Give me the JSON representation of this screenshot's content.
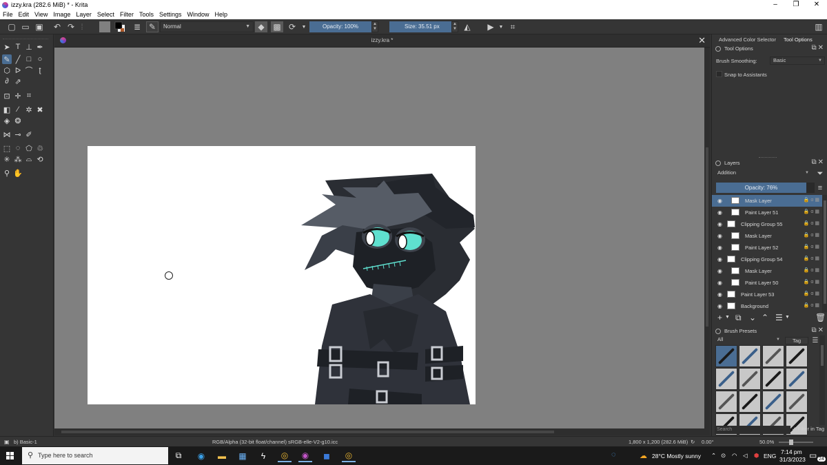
{
  "window": {
    "title": "izzy.kra (282.6 MiB)  * - Krita",
    "buttons": [
      "–",
      "❐",
      "✕"
    ]
  },
  "menu": [
    "File",
    "Edit",
    "View",
    "Image",
    "Layer",
    "Select",
    "Filter",
    "Tools",
    "Settings",
    "Window",
    "Help"
  ],
  "toolbar": {
    "blend_mode": "Normal",
    "opacity": "Opacity: 100%",
    "size": "Size: 35.51 px"
  },
  "document": {
    "tab_title": "izzy.kra *",
    "close": "✕"
  },
  "dock": {
    "tabs": [
      "Advanced Color Selector",
      "Tool Options"
    ],
    "tool_options": {
      "title": "Tool Options",
      "brush_smoothing_label": "Brush Smoothing:",
      "brush_smoothing_value": "Basic",
      "snap_label": "Snap to Assistants"
    },
    "layers": {
      "title": "Layers",
      "blend_mode": "Addition",
      "opacity": "Opacity:  76%",
      "items": [
        {
          "name": "Mask Layer",
          "selected": true,
          "indent": 2
        },
        {
          "name": "Paint Layer 51",
          "selected": false,
          "indent": 2
        },
        {
          "name": "Clipping Group 55",
          "selected": false,
          "indent": 1
        },
        {
          "name": "Mask Layer",
          "selected": false,
          "indent": 2
        },
        {
          "name": "Paint Layer 52",
          "selected": false,
          "indent": 2
        },
        {
          "name": "Clipping Group 54",
          "selected": false,
          "indent": 1
        },
        {
          "name": "Mask Layer",
          "selected": false,
          "indent": 2
        },
        {
          "name": "Paint Layer 50",
          "selected": false,
          "indent": 2
        },
        {
          "name": "Paint Layer 53",
          "selected": false,
          "indent": 1
        },
        {
          "name": "Background",
          "selected": false,
          "indent": 1
        }
      ]
    },
    "brush_presets": {
      "title": "Brush Presets",
      "filter": "All",
      "tag": "Tag",
      "search_placeholder": "Search",
      "filter_in_tag": "Filter in Tag"
    }
  },
  "status": {
    "preset": "b) Basic-1",
    "color_space": "RGB/Alpha (32-bit float/channel)  sRGB-elle-V2-g10.icc",
    "dimensions": "1,800 x 1,200 (282.6 MiB)",
    "rotation": "0.00°",
    "zoom": "50.0%"
  },
  "taskbar": {
    "search_placeholder": "Type here to search",
    "weather": "28°C  Mostly sunny",
    "language": "ENG",
    "time": "7:14 pm",
    "date": "31/3/2023",
    "notifications": "24"
  },
  "colors": {
    "accent": "#4a6d93",
    "panel_bg": "#353535",
    "canvas_bg": "#808080",
    "foreground_color": "#000000",
    "background_color": "#ffffff"
  }
}
